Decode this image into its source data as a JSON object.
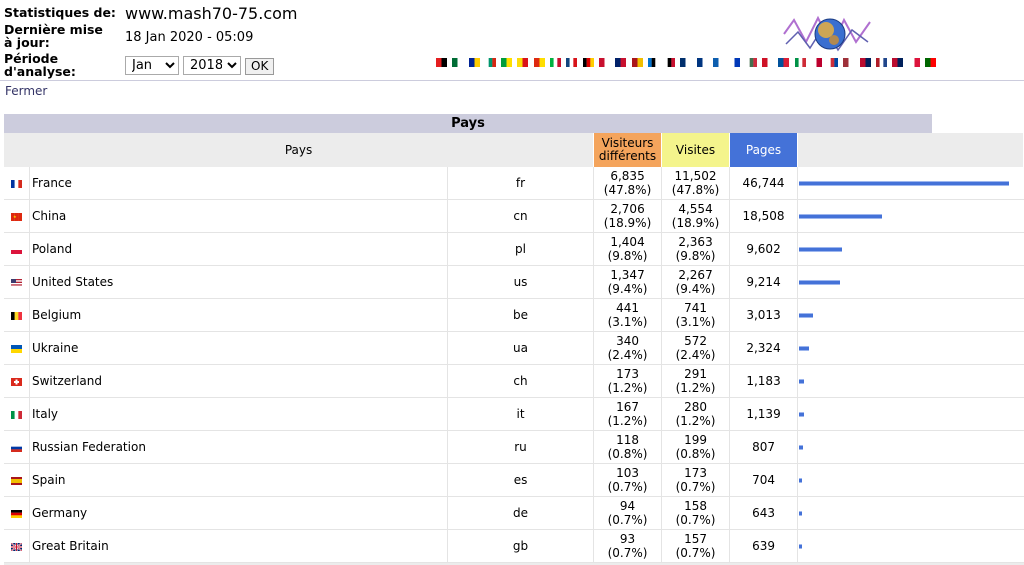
{
  "header": {
    "stats_label": "Statistiques de:",
    "site_name": "www.mash70-75.com",
    "update_label": "Dernière mise à jour:",
    "update_date": "18 Jan 2020 - 05:09",
    "period_label": "Période d'analyse:",
    "month_selected": "Jan",
    "year_selected": "2018",
    "ok_label": "OK"
  },
  "close_label": "Fermer",
  "section_title": "Pays",
  "columns": {
    "country": "Pays",
    "visitors_line1": "Visiteurs",
    "visitors_line2": "différents",
    "visits": "Visites",
    "pages": "Pages"
  },
  "colors": {
    "visitors_header": "#f4a45c",
    "visits_header": "#f4f48c",
    "pages_header": "#4472d8",
    "bar": "#4472d8"
  },
  "rows": [
    {
      "country": "France",
      "code": "fr",
      "visitors": "6,835",
      "visitors_pct": "(47.8%)",
      "visits": "11,502",
      "visits_pct": "(47.8%)",
      "pages": "46,744",
      "pages_value": 46744,
      "flag": [
        "#0033a0",
        "#fff",
        "#d52b1e"
      ],
      "flag_dir": "v"
    },
    {
      "country": "China",
      "code": "cn",
      "visitors": "2,706",
      "visitors_pct": "(18.9%)",
      "visits": "4,554",
      "visits_pct": "(18.9%)",
      "pages": "18,508",
      "pages_value": 18508,
      "flag": [
        "#de2910",
        "#de2910",
        "#de2910"
      ],
      "flag_dir": "v"
    },
    {
      "country": "Poland",
      "code": "pl",
      "visitors": "1,404",
      "visitors_pct": "(9.8%)",
      "visits": "2,363",
      "visits_pct": "(9.8%)",
      "pages": "9,602",
      "pages_value": 9602,
      "flag": [
        "#ffffff",
        "#dc143c"
      ],
      "flag_dir": "h"
    },
    {
      "country": "United States",
      "code": "us",
      "visitors": "1,347",
      "visitors_pct": "(9.4%)",
      "visits": "2,267",
      "visits_pct": "(9.4%)",
      "pages": "9,214",
      "pages_value": 9214,
      "flag": [
        "#b22234",
        "#ffffff",
        "#b22234",
        "#ffffff",
        "#3c3b6e"
      ],
      "flag_dir": "us"
    },
    {
      "country": "Belgium",
      "code": "be",
      "visitors": "441",
      "visitors_pct": "(3.1%)",
      "visits": "741",
      "visits_pct": "(3.1%)",
      "pages": "3,013",
      "pages_value": 3013,
      "flag": [
        "#000000",
        "#fdda24",
        "#ef3340"
      ],
      "flag_dir": "v"
    },
    {
      "country": "Ukraine",
      "code": "ua",
      "visitors": "340",
      "visitors_pct": "(2.4%)",
      "visits": "572",
      "visits_pct": "(2.4%)",
      "pages": "2,324",
      "pages_value": 2324,
      "flag": [
        "#0057b7",
        "#ffd700"
      ],
      "flag_dir": "h"
    },
    {
      "country": "Switzerland",
      "code": "ch",
      "visitors": "173",
      "visitors_pct": "(1.2%)",
      "visits": "291",
      "visits_pct": "(1.2%)",
      "pages": "1,183",
      "pages_value": 1183,
      "flag": [
        "#da291c"
      ],
      "flag_dir": "ch"
    },
    {
      "country": "Italy",
      "code": "it",
      "visitors": "167",
      "visitors_pct": "(1.2%)",
      "visits": "280",
      "visits_pct": "(1.2%)",
      "pages": "1,139",
      "pages_value": 1139,
      "flag": [
        "#009246",
        "#ffffff",
        "#ce2b37"
      ],
      "flag_dir": "v"
    },
    {
      "country": "Russian Federation",
      "code": "ru",
      "visitors": "118",
      "visitors_pct": "(0.8%)",
      "visits": "199",
      "visits_pct": "(0.8%)",
      "pages": "807",
      "pages_value": 807,
      "flag": [
        "#ffffff",
        "#0039a6",
        "#d52b1e"
      ],
      "flag_dir": "h"
    },
    {
      "country": "Spain",
      "code": "es",
      "visitors": "103",
      "visitors_pct": "(0.7%)",
      "visits": "173",
      "visits_pct": "(0.7%)",
      "pages": "704",
      "pages_value": 704,
      "flag": [
        "#aa151b",
        "#f1bf00",
        "#f1bf00",
        "#aa151b"
      ],
      "flag_dir": "h"
    },
    {
      "country": "Germany",
      "code": "de",
      "visitors": "94",
      "visitors_pct": "(0.7%)",
      "visits": "158",
      "visits_pct": "(0.7%)",
      "pages": "643",
      "pages_value": 643,
      "flag": [
        "#000000",
        "#dd0000",
        "#ffce00"
      ],
      "flag_dir": "h"
    },
    {
      "country": "Great Britain",
      "code": "gb",
      "visitors": "93",
      "visitors_pct": "(0.7%)",
      "visits": "157",
      "visits_pct": "(0.7%)",
      "pages": "639",
      "pages_value": 639,
      "flag": [
        "#012169",
        "#c8102e"
      ],
      "flag_dir": "gb"
    }
  ],
  "language_flags": [
    [
      "#e41e20",
      "#000000"
    ],
    [
      "#006c35",
      "#ffffff"
    ],
    [
      "#002395",
      "#fecb00"
    ],
    [
      "#ffffff",
      "#00966e",
      "#d62612"
    ],
    [
      "#009c3b",
      "#ffdf00"
    ],
    [
      "#fcdd09",
      "#da121a"
    ],
    [
      "#de2910",
      "#ffde00"
    ],
    [
      "#00b140",
      "#ffffff",
      "#c8102e"
    ],
    [
      "#11457e",
      "#ffffff",
      "#d7141a"
    ],
    [
      "#000000",
      "#dd0000",
      "#ffce00"
    ],
    [
      "#c8102e",
      "#ffffff"
    ],
    [
      "#012169",
      "#c8102e"
    ],
    [
      "#aa151b",
      "#f1bf00"
    ],
    [
      "#0072ce",
      "#000000",
      "#ffffff"
    ],
    [
      "#ffffff",
      "#000000",
      "#c8102e"
    ],
    [
      "#002f6c",
      "#ffffff"
    ],
    [
      "#003580",
      "#ffffff"
    ],
    [
      "#0d5eaf",
      "#ffffff"
    ],
    [
      "#ffffff",
      "#0038b8"
    ],
    [
      "#ffffff",
      "#436f4d",
      "#cd2a3e"
    ],
    [
      "#ce1126",
      "#ffffff"
    ],
    [
      "#02529c",
      "#dc1e35"
    ],
    [
      "#009246",
      "#ffffff",
      "#ce2b37"
    ],
    [
      "#ffffff",
      "#bc002d"
    ],
    [
      "#ffffff",
      "#cd2e3a",
      "#0047a0"
    ],
    [
      "#9e3039",
      "#ffffff"
    ],
    [
      "#ba0c2f",
      "#00205b"
    ],
    [
      "#ae1c28",
      "#ffffff",
      "#21468b"
    ],
    [
      "#ba0c2f",
      "#00205b"
    ],
    [
      "#ffffff",
      "#dc143c"
    ],
    [
      "#006600",
      "#ff0000"
    ]
  ]
}
